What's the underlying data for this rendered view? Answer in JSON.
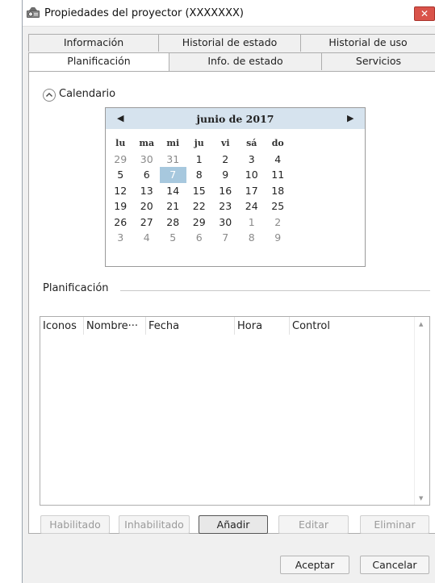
{
  "window": {
    "title": "Propiedades del proyector (XXXXXXX)",
    "close_glyph": "✕",
    "app_icon": "projector-icon"
  },
  "tabs": {
    "row1": [
      "Información",
      "Historial de estado",
      "Historial de uso"
    ],
    "row2": [
      "Planificación",
      "Info. de estado",
      "Servicios"
    ],
    "active": "Planificación"
  },
  "calendar": {
    "section_label": "Calendario",
    "collapse_icon": "chevron-up-icon",
    "month": "junio de 2017",
    "prev_glyph": "◀",
    "next_glyph": "▶",
    "weekdays": [
      "lu",
      "ma",
      "mi",
      "ju",
      "vi",
      "sá",
      "do"
    ],
    "weeks": [
      [
        "29",
        "30",
        "31",
        "1",
        "2",
        "3",
        "4"
      ],
      [
        "5",
        "6",
        "7",
        "8",
        "9",
        "10",
        "11"
      ],
      [
        "12",
        "13",
        "14",
        "15",
        "16",
        "17",
        "18"
      ],
      [
        "19",
        "20",
        "21",
        "22",
        "23",
        "24",
        "25"
      ],
      [
        "26",
        "27",
        "28",
        "29",
        "30",
        "1",
        "2"
      ],
      [
        "3",
        "4",
        "5",
        "6",
        "7",
        "8",
        "9"
      ]
    ],
    "selected": "7"
  },
  "schedule": {
    "section_label": "Planificación",
    "columns": [
      "Iconos",
      "Nombre···",
      "Fecha",
      "Hora",
      "Control"
    ],
    "rows": []
  },
  "actions": {
    "enabled": "Habilitado",
    "disabled": "Inhabilitado",
    "add": "Añadir",
    "edit": "Editar",
    "delete": "Eliminar"
  },
  "footer": {
    "ok": "Aceptar",
    "cancel": "Cancelar"
  },
  "colors": {
    "calendar_header": "#d6e3ee",
    "selected_day": "#a7c8de",
    "close_button": "#d9534a"
  }
}
